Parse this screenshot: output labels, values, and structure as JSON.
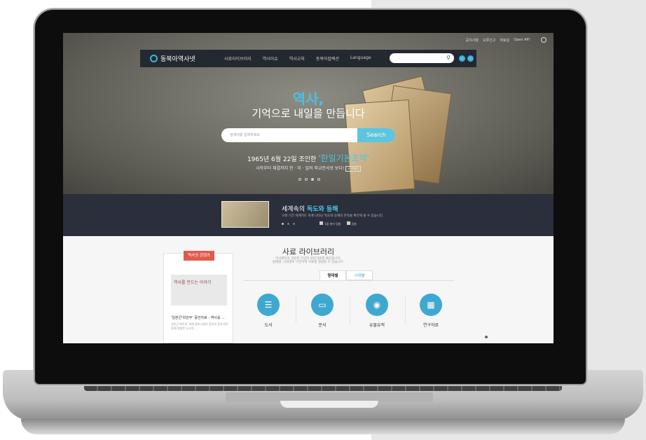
{
  "utility_links": [
    "공지사항",
    "오류신고",
    "자료실",
    "Open API"
  ],
  "site": {
    "name": "동북아역사넷"
  },
  "nav": {
    "items": [
      "사료라이브러리",
      "역사이슈",
      "역사교육",
      "동북아컬렉션",
      "Language"
    ]
  },
  "hero": {
    "title": "역사,",
    "subtitle": "기억으로 내일을 만듭니다",
    "search_placeholder": "검색어를 입력하세요",
    "search_button": "Search",
    "feature_prefix": "1965년 6월 22일 조인한",
    "feature_highlight": "'한일기본조약'",
    "feature_desc": "시작부터 체결까지 한 · 미 · 일의 외교문서로 보다!",
    "feature_more": "+ 자세히"
  },
  "band": {
    "title_prefix": "세계속의",
    "title_highlight": "독도와 동해",
    "desc": "오랜 기간 세계지도 속에 나타난 독도와 동해의 흔적을 확인해 볼 수 있습니다.",
    "control_play": "1월 별저 멈춤",
    "control_stop": "멈춤"
  },
  "card": {
    "tag": "역사넷 콘텐츠",
    "thumb_text": "역사를 만드는 이야기",
    "title": "'일본군'위안부' 증언자료 - 역사를 ...",
    "desc": "일본군'위안부' 피해 할머니들의 증언과 증언기록 등록(생생한 당시의..."
  },
  "library": {
    "title": "사료 라이브러리",
    "desc_line1": "역사편찬과 관련된 다양한 원문자료를 제공합니다.",
    "desc_line2": "형태별, 시대별로 구분하여 자료를 열람할 수 있습니다.",
    "tabs": [
      "형태별",
      "시대별"
    ],
    "categories": [
      "도서",
      "문서",
      "유물유적",
      "연구자료"
    ]
  },
  "colors": {
    "accent": "#3fa8d0",
    "brand_text": "#49c0e4",
    "tag_red": "#e05a4e",
    "band_bg": "#2b2e3b"
  }
}
